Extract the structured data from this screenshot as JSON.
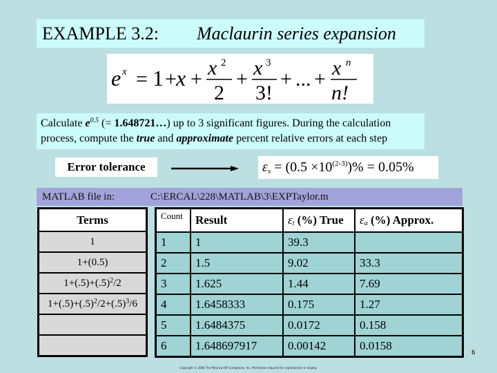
{
  "title": {
    "example": "EXAMPLE 3.2:",
    "subtitle": "Maclaurin series expansion"
  },
  "formula": {
    "lhs_base": "e",
    "lhs_exp": "x",
    "equals": "=",
    "term1": "1",
    "plus": "+",
    "term2": "x",
    "frac1_num_base": "x",
    "frac1_num_exp": "2",
    "frac1_den": "2",
    "frac2_num_base": "x",
    "frac2_num_exp": "3",
    "frac2_den": "3!",
    "ellipsis": "...",
    "fracn_num_base": "x",
    "fracn_num_exp": "n",
    "fracn_den": "n!"
  },
  "problem": {
    "p1": "Calculate ",
    "e_base": "e",
    "e_exp": "0.5",
    "p2": " (= ",
    "value": "1.648721…",
    "p3": ") up to 3 significant figures. During the calculation process, compute the ",
    "true_word": "true",
    "p4": " and ",
    "approx_word": "approximate",
    "p5": " percent relative errors at each step"
  },
  "tolerance": {
    "label": "Error tolerance",
    "eps": "ε",
    "eps_sub": "s",
    "expr_1": " = (0.5  ×10",
    "expr_sup": "(2-3)",
    "expr_2": ")% = 0.05%"
  },
  "matlab": {
    "label": "MATLAB file in:",
    "path": "C:\\ERCAL\\228\\MATLAB\\3\\EXPTaylor.m"
  },
  "terms_table": {
    "header": "Terms",
    "rows": [
      {
        "base": "1",
        "sup1": "",
        "mid": "",
        "sup2": "",
        "tail": ""
      },
      {
        "base": "1+(0.5)",
        "sup1": "",
        "mid": "",
        "sup2": "",
        "tail": ""
      },
      {
        "base": "1+(.5)+(.5)",
        "sup1": "2",
        "mid": "/2",
        "sup2": "",
        "tail": ""
      },
      {
        "base": "1+(.5)+(.5)",
        "sup1": "2",
        "mid": "/2+(.5)",
        "sup2": "3",
        "tail": "/6"
      },
      {
        "base": "",
        "sup1": "",
        "mid": "",
        "sup2": "",
        "tail": ""
      },
      {
        "base": "",
        "sup1": "",
        "mid": "",
        "sup2": "",
        "tail": ""
      }
    ]
  },
  "results_table": {
    "headers": {
      "count": "Count",
      "result": "Result",
      "true_eps": "ε",
      "true_sub": "t",
      "true_label": " (%)  True",
      "approx_eps": "ε",
      "approx_sub": "a",
      "approx_label": " (%)  Approx."
    },
    "rows": [
      {
        "count": "1",
        "result": "1",
        "et": "39.3",
        "ea": ""
      },
      {
        "count": "2",
        "result": "1.5",
        "et": "9.02",
        "ea": "33.3"
      },
      {
        "count": "3",
        "result": "1.625",
        "et": "1.44",
        "ea": "7.69"
      },
      {
        "count": "4",
        "result": "1.6458333",
        "et": "0.175",
        "ea": "1.27"
      },
      {
        "count": "5",
        "result": "1.6484375",
        "et": "0.0172",
        "ea": "0.158"
      },
      {
        "count": "6",
        "result": "1.648697917",
        "et": "0.00142",
        "ea": "0.0158"
      }
    ]
  },
  "page_number": "6",
  "copyright": "Copyright © 2006 The McGraw-Hill Companies, Inc. Permission required for reproduction or display."
}
